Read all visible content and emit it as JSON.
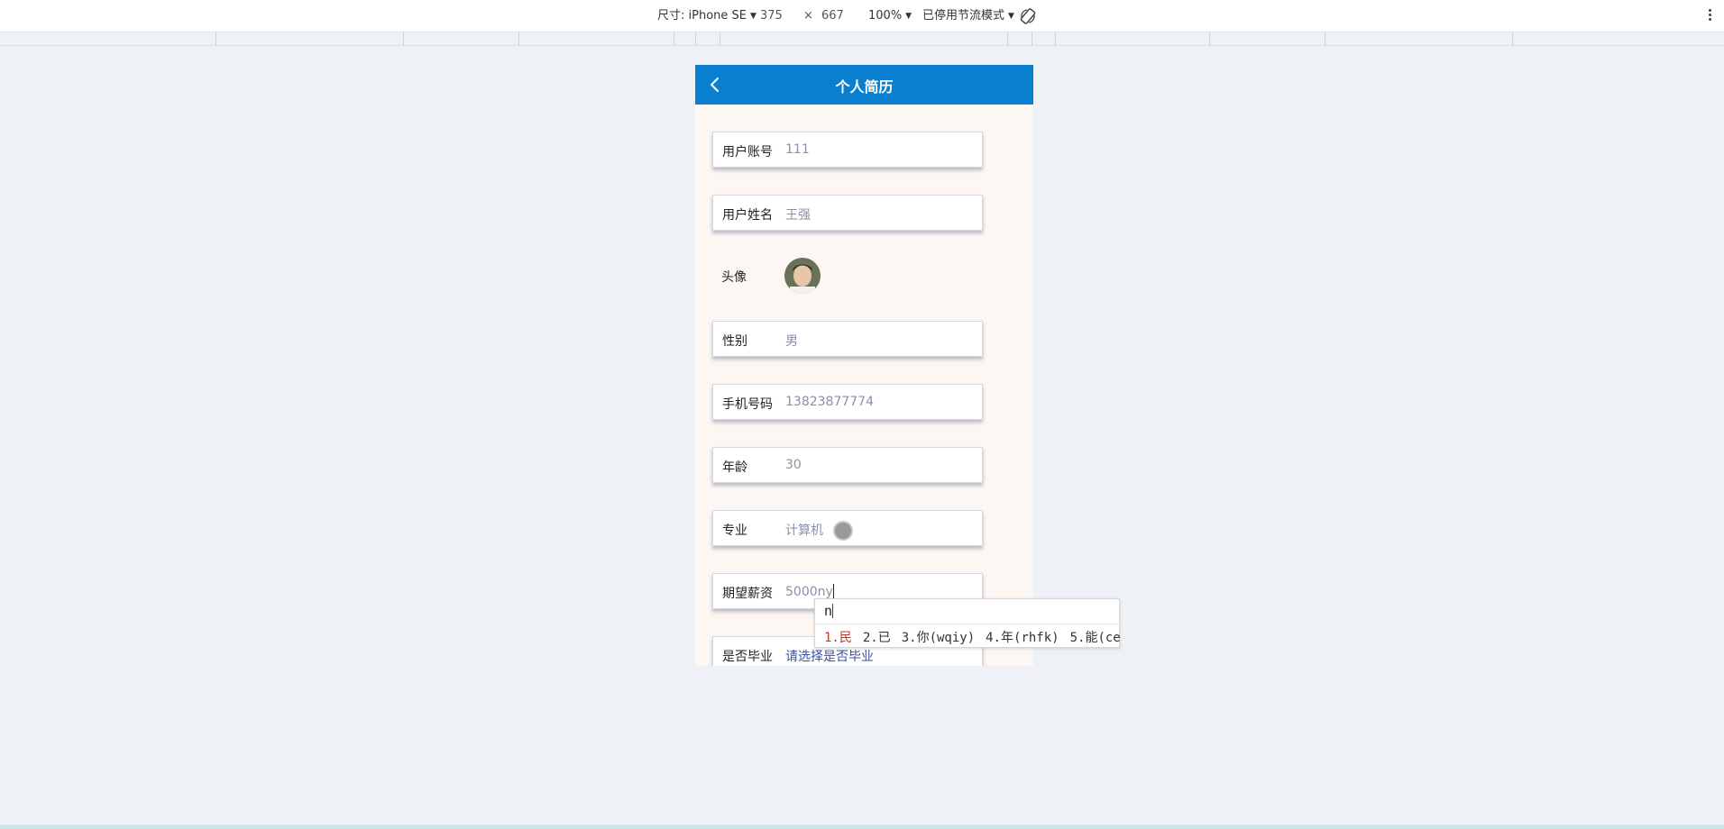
{
  "toolbar": {
    "size_label": "尺寸: iPhone SE",
    "width": "375",
    "times": "×",
    "height": "667",
    "zoom": "100%",
    "throttle": "已停用节流模式"
  },
  "app": {
    "title": "个人简历",
    "fields": [
      {
        "label": "用户账号",
        "value": "111"
      },
      {
        "label": "用户姓名",
        "value": "王强"
      },
      {
        "label": "头像",
        "value": ""
      },
      {
        "label": "性别",
        "value": "男"
      },
      {
        "label": "手机号码",
        "value": "13823877774"
      },
      {
        "label": "年龄",
        "value": "30"
      },
      {
        "label": "专业",
        "value": "计算机"
      },
      {
        "label": "期望薪资",
        "value": "5000ny"
      },
      {
        "label": "是否毕业",
        "value": "请选择是否毕业"
      }
    ]
  },
  "ime": {
    "composition": "n",
    "candidates": [
      "1.民",
      "2.已",
      "3.你(wqiy)",
      "4.年(rhfk)",
      "5.能(ce"
    ]
  },
  "colors": {
    "nav": "#0a7fd0",
    "background": "#eef1f6",
    "candidate_selected": "#c0392b"
  }
}
